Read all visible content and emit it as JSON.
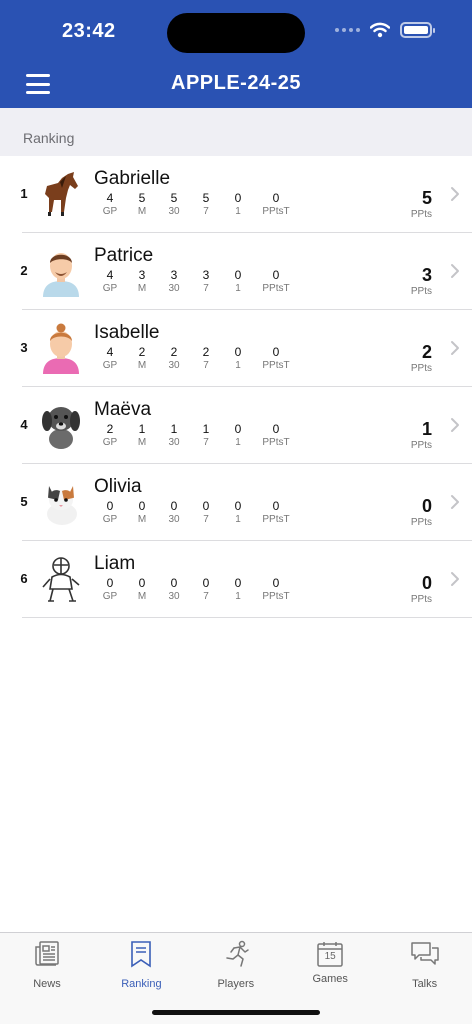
{
  "status_bar": {
    "time": "23:42"
  },
  "header": {
    "title": "APPLE-24-25"
  },
  "section": {
    "title": "Ranking"
  },
  "columns": [
    "GP",
    "M",
    "30",
    "7",
    "1",
    "PPtsT"
  ],
  "score_label": "PPts",
  "players": [
    {
      "rank": "1",
      "name": "Gabrielle",
      "stats": [
        "4",
        "5",
        "5",
        "5",
        "0",
        "0"
      ],
      "score": "5",
      "avatar": "horse"
    },
    {
      "rank": "2",
      "name": "Patrice",
      "stats": [
        "4",
        "3",
        "3",
        "3",
        "0",
        "0"
      ],
      "score": "3",
      "avatar": "man"
    },
    {
      "rank": "3",
      "name": "Isabelle",
      "stats": [
        "4",
        "2",
        "2",
        "2",
        "0",
        "0"
      ],
      "score": "2",
      "avatar": "woman"
    },
    {
      "rank": "4",
      "name": "Maëva",
      "stats": [
        "2",
        "1",
        "1",
        "1",
        "0",
        "0"
      ],
      "score": "1",
      "avatar": "dog"
    },
    {
      "rank": "5",
      "name": "Olivia",
      "stats": [
        "0",
        "0",
        "0",
        "0",
        "0",
        "0"
      ],
      "score": "0",
      "avatar": "cat"
    },
    {
      "rank": "6",
      "name": "Liam",
      "stats": [
        "0",
        "0",
        "0",
        "0",
        "0",
        "0"
      ],
      "score": "0",
      "avatar": "knight"
    }
  ],
  "tabs": [
    {
      "label": "News",
      "icon": "newspaper-icon"
    },
    {
      "label": "Ranking",
      "icon": "ranking-icon",
      "active": true
    },
    {
      "label": "Players",
      "icon": "runner-icon"
    },
    {
      "label": "Games",
      "icon": "calendar-icon",
      "calendar_day": "15"
    },
    {
      "label": "Talks",
      "icon": "chat-icon"
    }
  ],
  "colors": {
    "header": "#2a52b3",
    "accent": "#3b5fb8",
    "section_bg": "#efeff4"
  }
}
